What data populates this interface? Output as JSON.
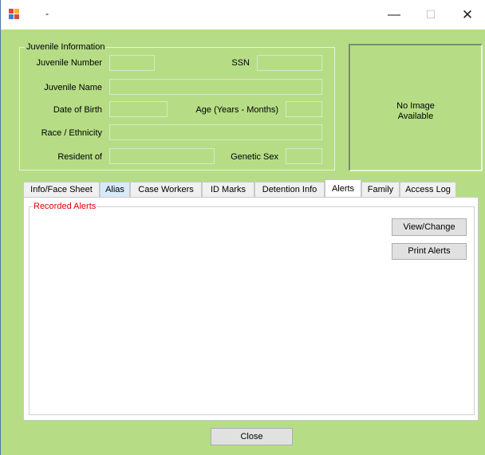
{
  "window": {
    "title": "-",
    "min_glyph": "—",
    "max_glyph": "☐",
    "close_glyph": "✕"
  },
  "juvenile_info": {
    "group_title": "Juvenile Information",
    "juvenile_number_label": "Juvenile Number",
    "ssn_label": "SSN",
    "juvenile_name_label": "Juvenile Name",
    "dob_label": "Date of Birth",
    "age_label": "Age (Years - Months)",
    "race_label": "Race / Ethnicity",
    "resident_label": "Resident of",
    "genetic_sex_label": "Genetic Sex",
    "juvenile_number": "",
    "ssn": "",
    "juvenile_name": "",
    "dob": "",
    "age": "",
    "race": "",
    "resident": "",
    "genetic_sex": ""
  },
  "photo": {
    "line1": "No Image",
    "line2": "Available"
  },
  "tabs": [
    {
      "label": "Info/Face Sheet"
    },
    {
      "label": "Alias"
    },
    {
      "label": "Case Workers"
    },
    {
      "label": "ID Marks"
    },
    {
      "label": "Detention Info"
    },
    {
      "label": "Alerts"
    },
    {
      "label": "Family"
    },
    {
      "label": "Access Log"
    }
  ],
  "alerts": {
    "group_title": "Recorded Alerts",
    "view_change_label": "View/Change",
    "print_label": "Print Alerts"
  },
  "footer": {
    "close_label": "Close"
  },
  "colors": {
    "window_bg": "#b6dd86",
    "alert_title": "#e00000"
  }
}
